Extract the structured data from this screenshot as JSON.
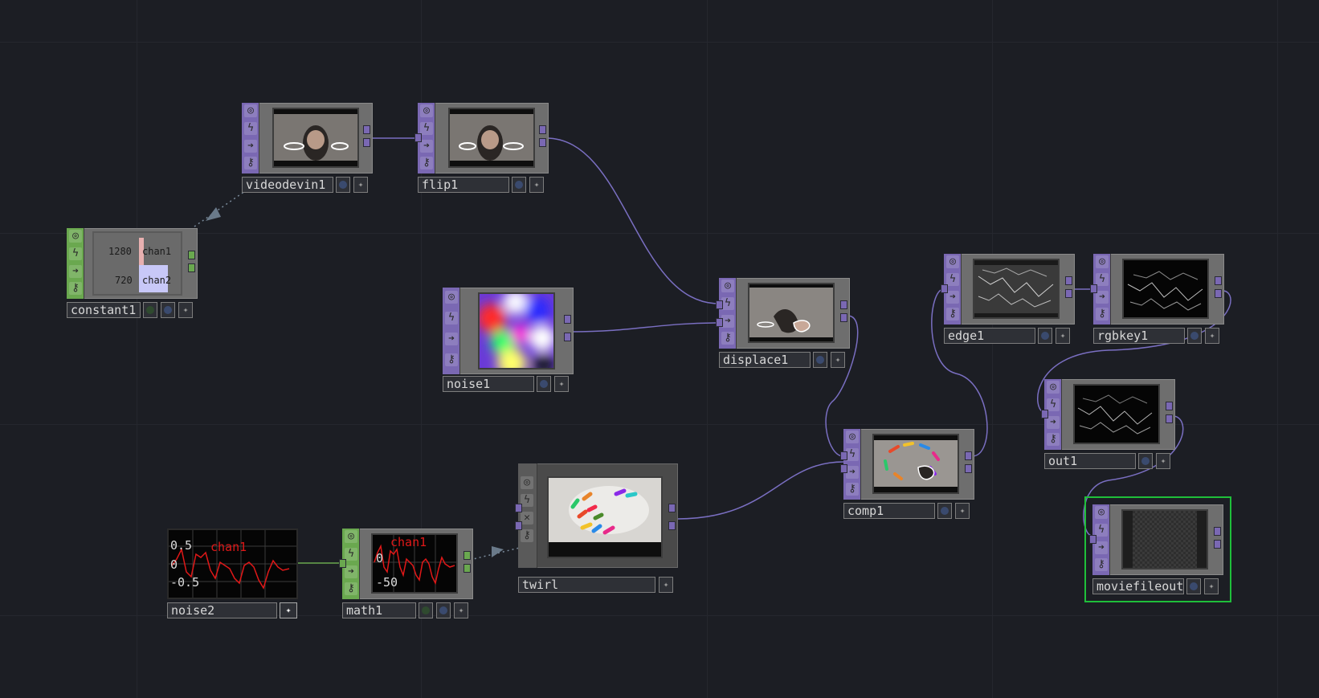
{
  "app": {
    "accent_top": "#7a68b3",
    "accent_chop": "#6aa84f",
    "selection": "#1fbf3a",
    "wire": "#7a6fc2",
    "background": "#1c1e24"
  },
  "nodes": {
    "videodevin1": {
      "name": "videodevin1",
      "family": "TOP"
    },
    "flip1": {
      "name": "flip1",
      "family": "TOP"
    },
    "constant1": {
      "name": "constant1",
      "family": "CHOP",
      "channels": [
        {
          "value": "1280",
          "name": "chan1"
        },
        {
          "value": "720",
          "name": "chan2"
        }
      ]
    },
    "noise1": {
      "name": "noise1",
      "family": "TOP"
    },
    "displace1": {
      "name": "displace1",
      "family": "TOP"
    },
    "edge1": {
      "name": "edge1",
      "family": "TOP"
    },
    "rgbkey1": {
      "name": "rgbkey1",
      "family": "TOP"
    },
    "out1": {
      "name": "out1",
      "family": "TOP"
    },
    "comp1": {
      "name": "comp1",
      "family": "TOP"
    },
    "twirl": {
      "name": "twirl",
      "family": "TOP"
    },
    "moviefileout1": {
      "name": "moviefileout1",
      "family": "TOP",
      "selected": true
    },
    "noise2": {
      "name": "noise2",
      "family": "CHOP",
      "chart_labels": {
        "channel": "chan1",
        "top": "0.5",
        "mid": "0",
        "bottom": "-0.5"
      }
    },
    "math1": {
      "name": "math1",
      "family": "CHOP",
      "chart_labels": {
        "channel": "chan1",
        "mid": "0",
        "bottom": "-50"
      }
    }
  },
  "icons": {
    "viewer": "target-icon",
    "bypass": "lightning-icon",
    "display": "arrow-right-icon",
    "lock": "lock-icon",
    "pin": "star-icon",
    "delete": "x-icon"
  }
}
